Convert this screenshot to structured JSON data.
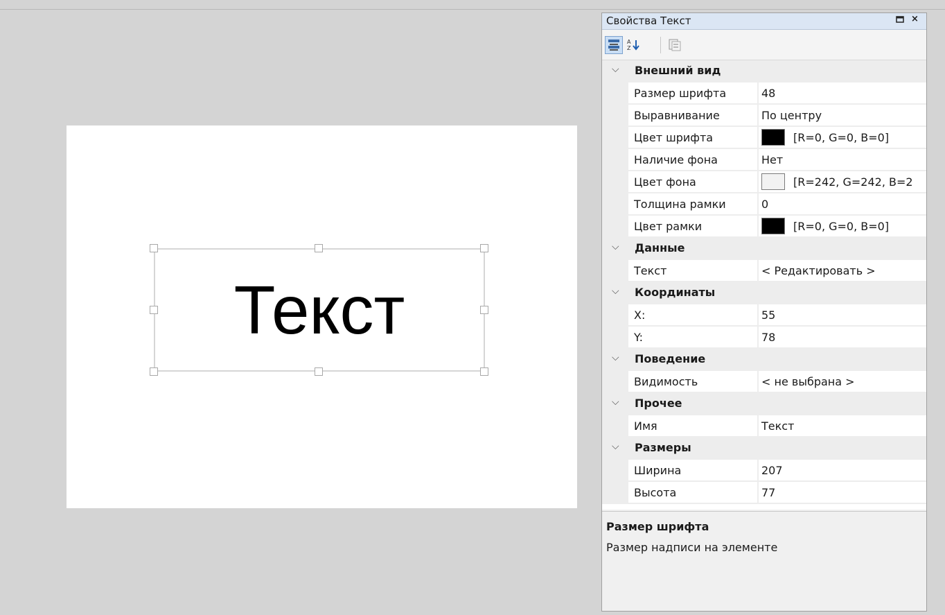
{
  "canvas": {
    "text": "Текст"
  },
  "panel": {
    "title": "Свойства Текст",
    "maximize_icon": "maximize-icon",
    "close_icon": "close-icon",
    "toolbar": [
      "categorized-icon",
      "alphabetical-sort-icon",
      "property-pages-icon"
    ],
    "categories": [
      {
        "label": "Внешний вид",
        "props": [
          {
            "name": "Размер шрифта",
            "value": "48"
          },
          {
            "name": "Выравнивание",
            "value": "По центру"
          },
          {
            "name": "Цвет шрифта",
            "value": "[R=0, G=0, B=0]",
            "color": "#000000"
          },
          {
            "name": "Наличие фона",
            "value": "Нет"
          },
          {
            "name": "Цвет фона",
            "value": "[R=242, G=242, B=2",
            "color": "#f2f2f2"
          },
          {
            "name": "Толщина рамки",
            "value": "0"
          },
          {
            "name": "Цвет рамки",
            "value": "[R=0, G=0, B=0]",
            "color": "#000000"
          }
        ]
      },
      {
        "label": "Данные",
        "props": [
          {
            "name": "Текст",
            "value": "< Редактировать >"
          }
        ]
      },
      {
        "label": "Координаты",
        "props": [
          {
            "name": "X:",
            "value": "55"
          },
          {
            "name": "Y:",
            "value": "78"
          }
        ]
      },
      {
        "label": "Поведение",
        "props": [
          {
            "name": "Видимость",
            "value": "< не выбрана >"
          }
        ]
      },
      {
        "label": "Прочее",
        "props": [
          {
            "name": "Имя",
            "value": "Текст"
          }
        ]
      },
      {
        "label": "Размеры",
        "props": [
          {
            "name": "Ширина",
            "value": "207"
          },
          {
            "name": "Высота",
            "value": "77"
          }
        ]
      }
    ],
    "description": {
      "title": "Размер шрифта",
      "text": "Размер надписи на элементе"
    }
  }
}
